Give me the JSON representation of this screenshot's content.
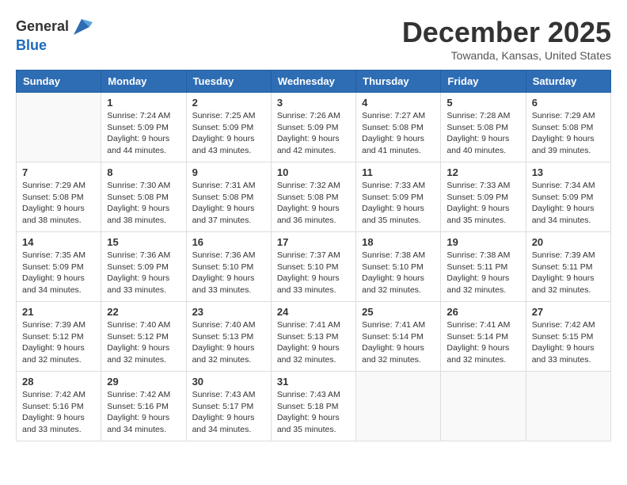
{
  "header": {
    "logo_line1": "General",
    "logo_line2": "Blue",
    "month_year": "December 2025",
    "location": "Towanda, Kansas, United States"
  },
  "days_of_week": [
    "Sunday",
    "Monday",
    "Tuesday",
    "Wednesday",
    "Thursday",
    "Friday",
    "Saturday"
  ],
  "weeks": [
    [
      {
        "day": "",
        "info": ""
      },
      {
        "day": "1",
        "info": "Sunrise: 7:24 AM\nSunset: 5:09 PM\nDaylight: 9 hours\nand 44 minutes."
      },
      {
        "day": "2",
        "info": "Sunrise: 7:25 AM\nSunset: 5:09 PM\nDaylight: 9 hours\nand 43 minutes."
      },
      {
        "day": "3",
        "info": "Sunrise: 7:26 AM\nSunset: 5:09 PM\nDaylight: 9 hours\nand 42 minutes."
      },
      {
        "day": "4",
        "info": "Sunrise: 7:27 AM\nSunset: 5:08 PM\nDaylight: 9 hours\nand 41 minutes."
      },
      {
        "day": "5",
        "info": "Sunrise: 7:28 AM\nSunset: 5:08 PM\nDaylight: 9 hours\nand 40 minutes."
      },
      {
        "day": "6",
        "info": "Sunrise: 7:29 AM\nSunset: 5:08 PM\nDaylight: 9 hours\nand 39 minutes."
      }
    ],
    [
      {
        "day": "7",
        "info": "Sunrise: 7:29 AM\nSunset: 5:08 PM\nDaylight: 9 hours\nand 38 minutes."
      },
      {
        "day": "8",
        "info": "Sunrise: 7:30 AM\nSunset: 5:08 PM\nDaylight: 9 hours\nand 38 minutes."
      },
      {
        "day": "9",
        "info": "Sunrise: 7:31 AM\nSunset: 5:08 PM\nDaylight: 9 hours\nand 37 minutes."
      },
      {
        "day": "10",
        "info": "Sunrise: 7:32 AM\nSunset: 5:08 PM\nDaylight: 9 hours\nand 36 minutes."
      },
      {
        "day": "11",
        "info": "Sunrise: 7:33 AM\nSunset: 5:09 PM\nDaylight: 9 hours\nand 35 minutes."
      },
      {
        "day": "12",
        "info": "Sunrise: 7:33 AM\nSunset: 5:09 PM\nDaylight: 9 hours\nand 35 minutes."
      },
      {
        "day": "13",
        "info": "Sunrise: 7:34 AM\nSunset: 5:09 PM\nDaylight: 9 hours\nand 34 minutes."
      }
    ],
    [
      {
        "day": "14",
        "info": "Sunrise: 7:35 AM\nSunset: 5:09 PM\nDaylight: 9 hours\nand 34 minutes."
      },
      {
        "day": "15",
        "info": "Sunrise: 7:36 AM\nSunset: 5:09 PM\nDaylight: 9 hours\nand 33 minutes."
      },
      {
        "day": "16",
        "info": "Sunrise: 7:36 AM\nSunset: 5:10 PM\nDaylight: 9 hours\nand 33 minutes."
      },
      {
        "day": "17",
        "info": "Sunrise: 7:37 AM\nSunset: 5:10 PM\nDaylight: 9 hours\nand 33 minutes."
      },
      {
        "day": "18",
        "info": "Sunrise: 7:38 AM\nSunset: 5:10 PM\nDaylight: 9 hours\nand 32 minutes."
      },
      {
        "day": "19",
        "info": "Sunrise: 7:38 AM\nSunset: 5:11 PM\nDaylight: 9 hours\nand 32 minutes."
      },
      {
        "day": "20",
        "info": "Sunrise: 7:39 AM\nSunset: 5:11 PM\nDaylight: 9 hours\nand 32 minutes."
      }
    ],
    [
      {
        "day": "21",
        "info": "Sunrise: 7:39 AM\nSunset: 5:12 PM\nDaylight: 9 hours\nand 32 minutes."
      },
      {
        "day": "22",
        "info": "Sunrise: 7:40 AM\nSunset: 5:12 PM\nDaylight: 9 hours\nand 32 minutes."
      },
      {
        "day": "23",
        "info": "Sunrise: 7:40 AM\nSunset: 5:13 PM\nDaylight: 9 hours\nand 32 minutes."
      },
      {
        "day": "24",
        "info": "Sunrise: 7:41 AM\nSunset: 5:13 PM\nDaylight: 9 hours\nand 32 minutes."
      },
      {
        "day": "25",
        "info": "Sunrise: 7:41 AM\nSunset: 5:14 PM\nDaylight: 9 hours\nand 32 minutes."
      },
      {
        "day": "26",
        "info": "Sunrise: 7:41 AM\nSunset: 5:14 PM\nDaylight: 9 hours\nand 32 minutes."
      },
      {
        "day": "27",
        "info": "Sunrise: 7:42 AM\nSunset: 5:15 PM\nDaylight: 9 hours\nand 33 minutes."
      }
    ],
    [
      {
        "day": "28",
        "info": "Sunrise: 7:42 AM\nSunset: 5:16 PM\nDaylight: 9 hours\nand 33 minutes."
      },
      {
        "day": "29",
        "info": "Sunrise: 7:42 AM\nSunset: 5:16 PM\nDaylight: 9 hours\nand 34 minutes."
      },
      {
        "day": "30",
        "info": "Sunrise: 7:43 AM\nSunset: 5:17 PM\nDaylight: 9 hours\nand 34 minutes."
      },
      {
        "day": "31",
        "info": "Sunrise: 7:43 AM\nSunset: 5:18 PM\nDaylight: 9 hours\nand 35 minutes."
      },
      {
        "day": "",
        "info": ""
      },
      {
        "day": "",
        "info": ""
      },
      {
        "day": "",
        "info": ""
      }
    ]
  ]
}
